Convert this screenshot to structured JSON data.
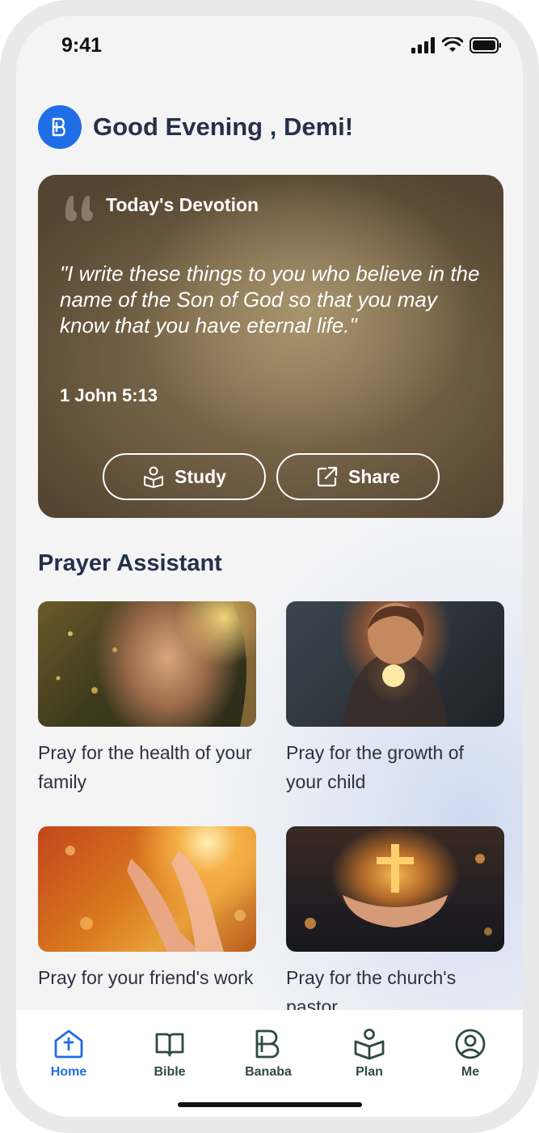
{
  "status_bar": {
    "time": "9:41"
  },
  "header": {
    "greeting": "Good Evening , Demi!"
  },
  "devotion": {
    "title": "Today's Devotion",
    "verse": "\"I write these things to you who believe in the name of the Son of God so that you may know that you have eternal life.\"",
    "reference": "1 John 5:13",
    "study_label": "Study",
    "share_label": "Share"
  },
  "prayer_assistant": {
    "title": "Prayer Assistant",
    "cards": [
      {
        "label": "Pray for the health of your family"
      },
      {
        "label": "Pray for the growth of your child"
      },
      {
        "label": "Pray for your friend's work"
      },
      {
        "label": "Pray for the church's pastor"
      }
    ]
  },
  "tab_bar": {
    "items": [
      {
        "label": "Home",
        "icon": "church-home-icon",
        "active": true
      },
      {
        "label": "Bible",
        "icon": "book-icon",
        "active": false
      },
      {
        "label": "Banaba",
        "icon": "banaba-logo-icon",
        "active": false
      },
      {
        "label": "Plan",
        "icon": "plan-reading-icon",
        "active": false
      },
      {
        "label": "Me",
        "icon": "profile-icon",
        "active": false
      }
    ]
  },
  "colors": {
    "accent": "#1f6ee6",
    "heading": "#25304a",
    "tab_inactive": "#2e4a44"
  }
}
